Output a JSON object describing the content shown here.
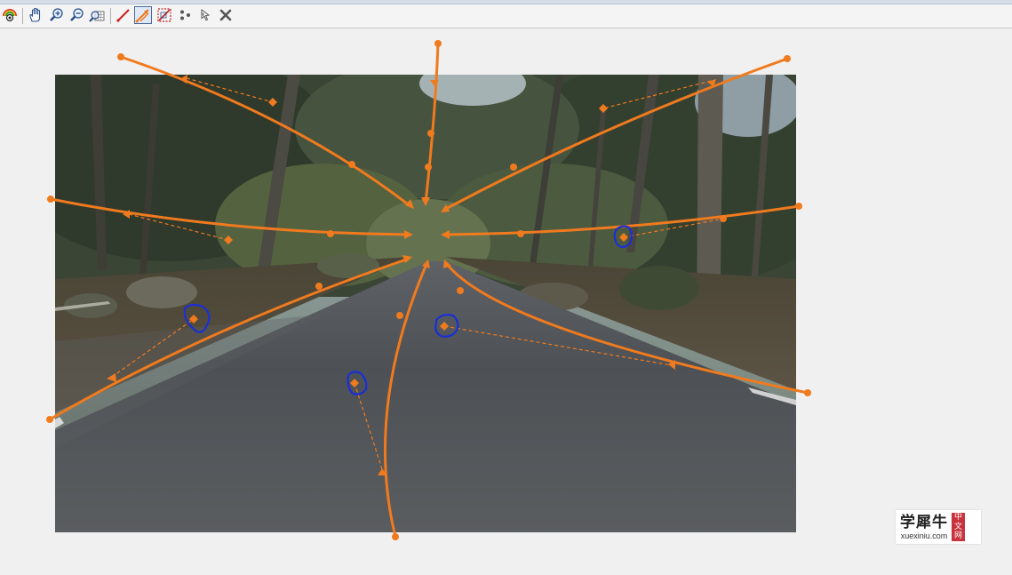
{
  "toolbar": {
    "buttons": [
      {
        "name": "view-mode-icon",
        "icon": "eye-rainbow-icon"
      },
      {
        "name": "pan-hand-icon",
        "icon": "hand-icon"
      },
      {
        "name": "zoom-in-icon",
        "icon": "magnifier-plus-icon"
      },
      {
        "name": "zoom-out-icon",
        "icon": "magnifier-minus-icon"
      },
      {
        "name": "zoom-fit-icon",
        "icon": "magnifier-grid-icon"
      },
      {
        "name": "draw-line-icon",
        "icon": "pencil-line-icon"
      },
      {
        "name": "perspective-arrows-icon",
        "icon": "orange-arrows-icon",
        "active": true
      },
      {
        "name": "erase-line-icon",
        "icon": "dashed-red-box-icon"
      },
      {
        "name": "node-points-icon",
        "icon": "dots-icon"
      },
      {
        "name": "cursor-node-icon",
        "icon": "pointer-node-icon"
      },
      {
        "name": "close-icon",
        "icon": "x-icon"
      }
    ]
  },
  "overlay_style": {
    "curve_color": "#f07a1e",
    "guide_color": "#f07a1e",
    "selection_color": "#1a2fd6"
  },
  "watermark": {
    "chinese": "学犀牛",
    "url": "xuexiniu.com",
    "badge": [
      "中",
      "文",
      "网"
    ],
    "badge_color": "#c8323c"
  }
}
